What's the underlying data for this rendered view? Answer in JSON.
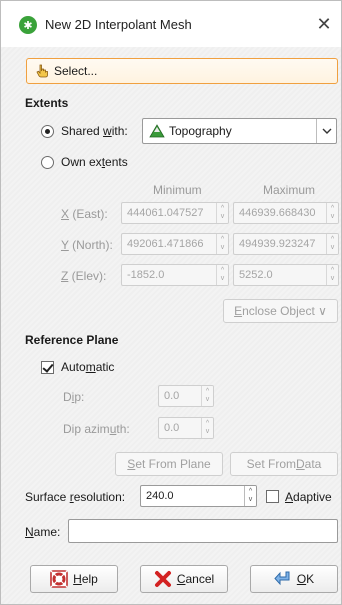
{
  "window": {
    "title": "New 2D Interpolant Mesh",
    "close_glyph": "✕"
  },
  "select_button": {
    "label": "Select..."
  },
  "extents": {
    "heading": "Extents",
    "shared_with": {
      "label_pre": "Shared ",
      "label_u": "w",
      "label_post": "ith:",
      "checked": true
    },
    "shared_with_value": "Topography",
    "own_extents": {
      "label_pre": "Own ex",
      "label_u": "t",
      "label_post": "ents",
      "checked": false
    },
    "columns": {
      "minimum": "Minimum",
      "maximum": "Maximum"
    },
    "rows": [
      {
        "label_u": "X",
        "label_rest": " (East):",
        "min": "444061.047527",
        "max": "446939.668430"
      },
      {
        "label_u": "Y",
        "label_rest": " (North):",
        "min": "492061.471866",
        "max": "494939.923247"
      },
      {
        "label_u": "Z",
        "label_rest": " (Elev):",
        "min": "-1852.0",
        "max": "5252.0"
      }
    ],
    "enclose_object": {
      "label_u": "E",
      "label_rest": "nclose Object",
      "arrow": "∨"
    }
  },
  "reference_plane": {
    "heading": "Reference Plane",
    "automatic": {
      "label_pre": "Auto",
      "label_u": "m",
      "label_post": "atic",
      "checked": true
    },
    "dip": {
      "label_pre": "D",
      "label_u": "i",
      "label_post": "p:",
      "value": "0.0"
    },
    "dip_azimuth": {
      "label_pre": "Dip azim",
      "label_u": "u",
      "label_post": "th:",
      "value": "0.0"
    },
    "set_from_plane": {
      "label_u": "S",
      "label_rest": "et From Plane"
    },
    "set_from_data": {
      "label_pre": "Set From ",
      "label_u": "D",
      "label_post": "ata"
    }
  },
  "surface_resolution": {
    "label_pre": "Surface ",
    "label_u": "r",
    "label_post": "esolution:",
    "value": "240.0",
    "adaptive": {
      "label_u": "A",
      "label_rest": "daptive",
      "checked": false
    }
  },
  "name_field": {
    "label_u": "N",
    "label_rest": "ame:",
    "value": ""
  },
  "buttons": {
    "help": {
      "label_u": "H",
      "label_rest": "elp"
    },
    "cancel": {
      "label_u": "C",
      "label_rest": "ancel"
    },
    "ok": {
      "label_u": "O",
      "label_rest": "K"
    }
  },
  "colors": {
    "select_border": "#f0a040",
    "title_icon": "#3aa23a",
    "disabled_text": "#9a9a9a"
  },
  "icons": {
    "title": "interpolant-mesh-icon",
    "select": "hand-pointer-icon",
    "topography": "topography-icon",
    "help": "help-lifebuoy-icon",
    "cancel": "cancel-x-icon",
    "ok": "ok-arrow-icon"
  }
}
